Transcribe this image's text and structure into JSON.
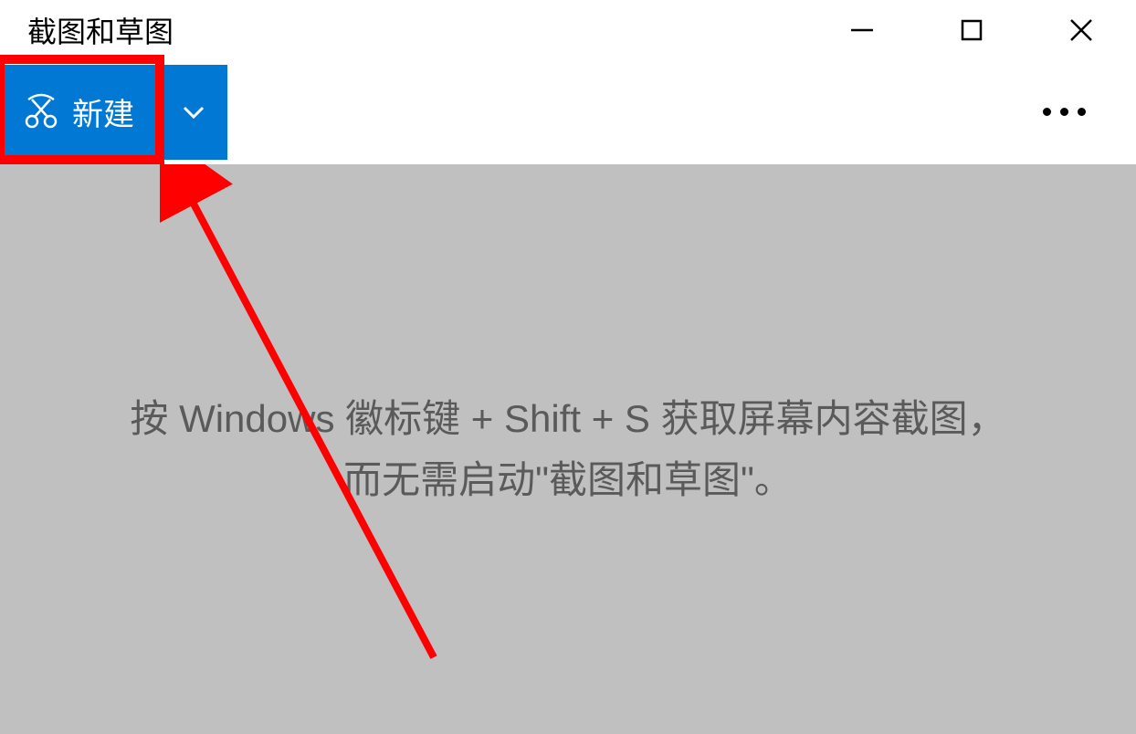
{
  "window": {
    "title": "截图和草图"
  },
  "toolbar": {
    "new_label": "新建"
  },
  "content": {
    "hint_line1": "按 Windows 徽标键 + Shift + S 获取屏幕内容截图，",
    "hint_line2": "而无需启动\"截图和草图\"。"
  }
}
